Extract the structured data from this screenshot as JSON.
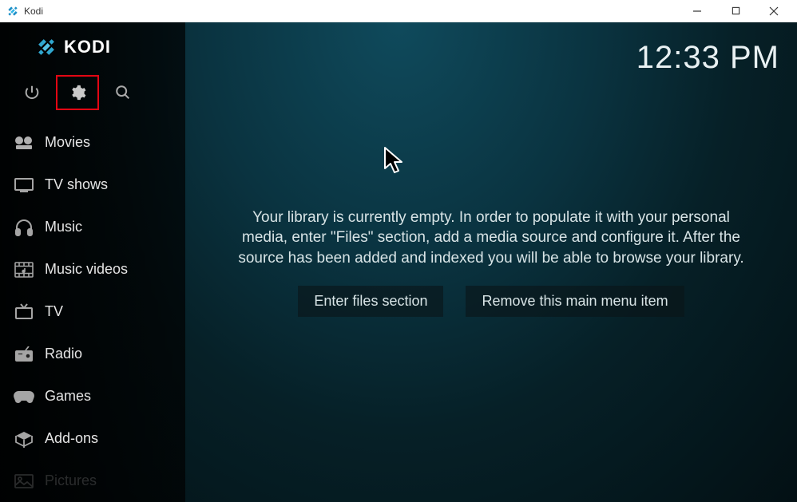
{
  "window": {
    "title": "Kodi"
  },
  "logo": {
    "text": "KODI"
  },
  "clock": "12:33 PM",
  "nav": {
    "items": [
      {
        "label": "Movies",
        "icon": "film-icon"
      },
      {
        "label": "TV shows",
        "icon": "tv-icon"
      },
      {
        "label": "Music",
        "icon": "headphones-icon"
      },
      {
        "label": "Music videos",
        "icon": "musicvideo-icon"
      },
      {
        "label": "TV",
        "icon": "livetv-icon"
      },
      {
        "label": "Radio",
        "icon": "radio-icon"
      },
      {
        "label": "Games",
        "icon": "gamepad-icon"
      },
      {
        "label": "Add-ons",
        "icon": "addons-icon"
      },
      {
        "label": "Pictures",
        "icon": "pictures-icon"
      }
    ]
  },
  "main": {
    "empty_message": "Your library is currently empty. In order to populate it with your personal media, enter \"Files\" section, add a media source and configure it. After the source has been added and indexed you will be able to browse your library.",
    "enter_files_label": "Enter files section",
    "remove_item_label": "Remove this main menu item"
  },
  "topicons": {
    "power": "power-icon",
    "settings": "gear-icon",
    "search": "search-icon"
  }
}
